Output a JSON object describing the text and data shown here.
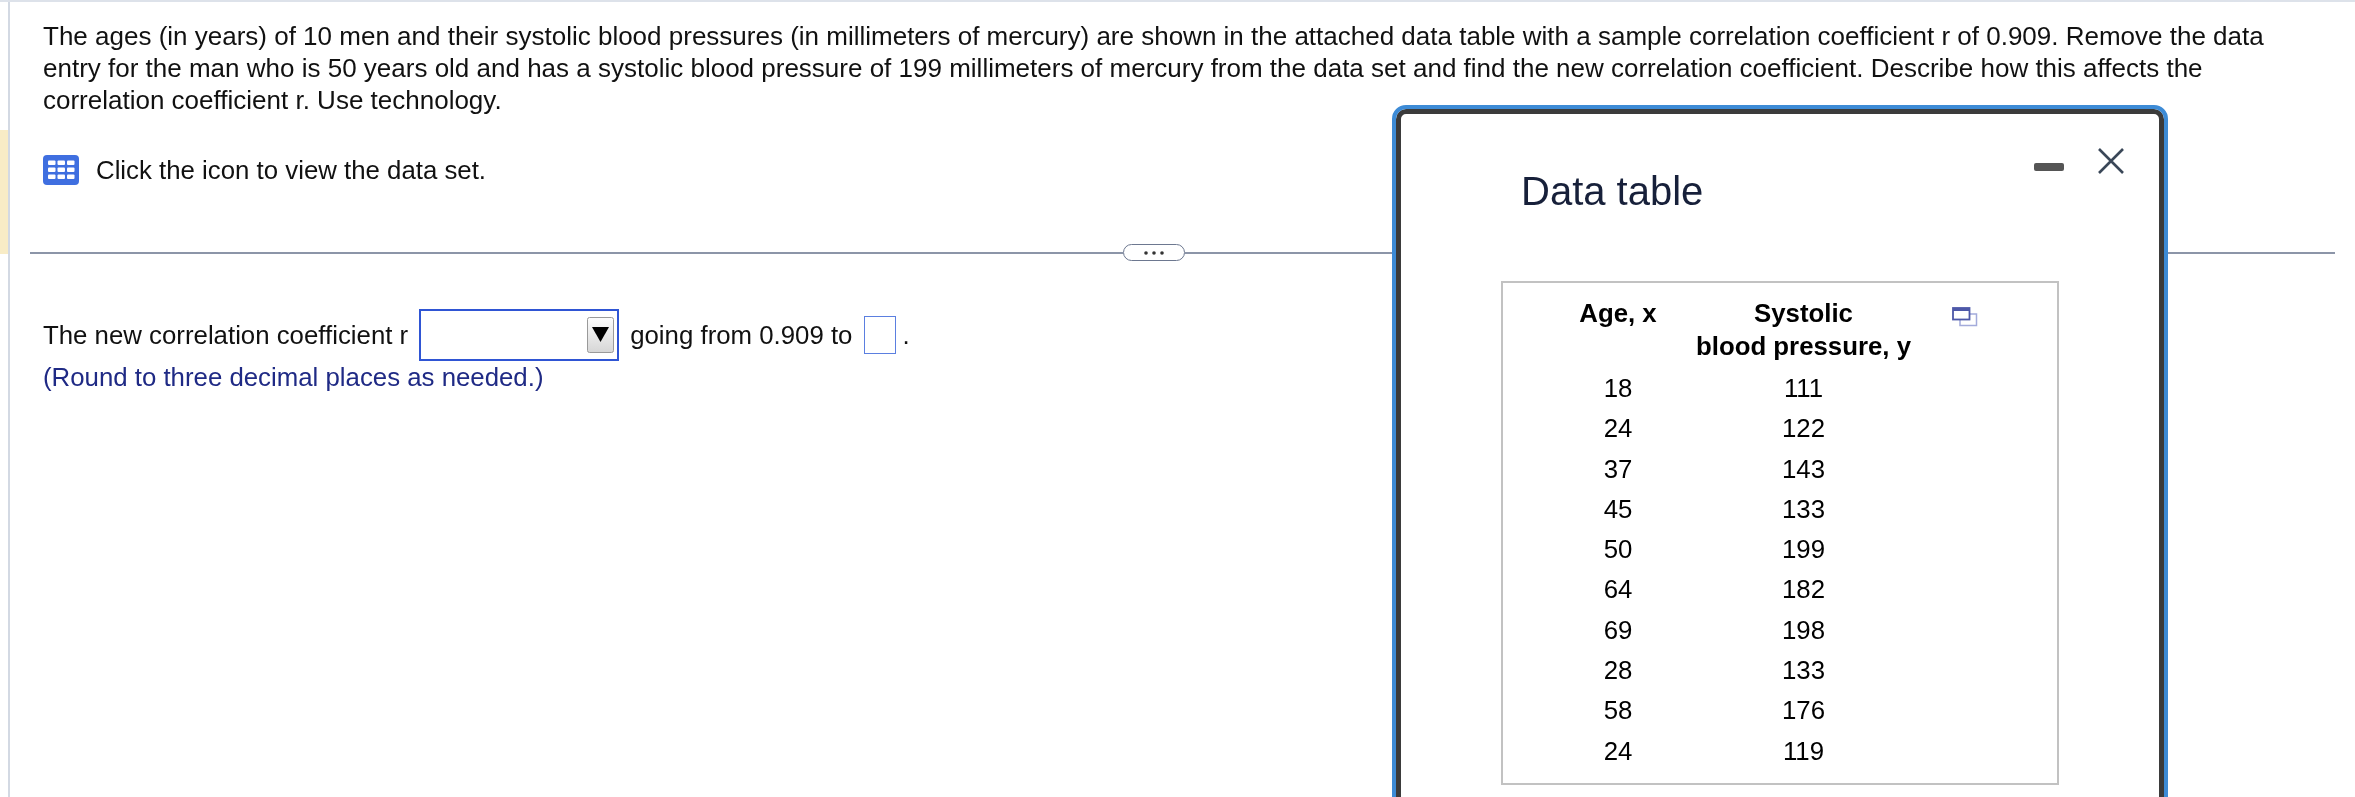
{
  "question": {
    "text": "The ages (in years) of 10 men and their systolic blood pressures (in millimeters of mercury) are shown in the attached data table with a sample correlation coefficient r of 0.909. Remove the data entry for the man who is 50 years old and has a systolic blood pressure of 199 millimeters of mercury from the data set and find the new correlation coefficient. Describe how this affects the correlation coefficient r. Use technology."
  },
  "data_link": {
    "text": "Click the icon to view the data set."
  },
  "answer": {
    "prefix": "The new correlation coefficient r",
    "middle": "going from 0.909 to",
    "suffix": ".",
    "hint": "(Round to three decimal places as needed.)"
  },
  "data_table_window": {
    "title": "Data table",
    "columns": [
      "Age, x",
      "Systolic\nblood pressure, y"
    ],
    "rows": [
      [
        "18",
        "111"
      ],
      [
        "24",
        "122"
      ],
      [
        "37",
        "143"
      ],
      [
        "45",
        "133"
      ],
      [
        "50",
        "199"
      ],
      [
        "64",
        "182"
      ],
      [
        "69",
        "198"
      ],
      [
        "28",
        "133"
      ],
      [
        "58",
        "176"
      ],
      [
        "24",
        "119"
      ]
    ]
  }
}
